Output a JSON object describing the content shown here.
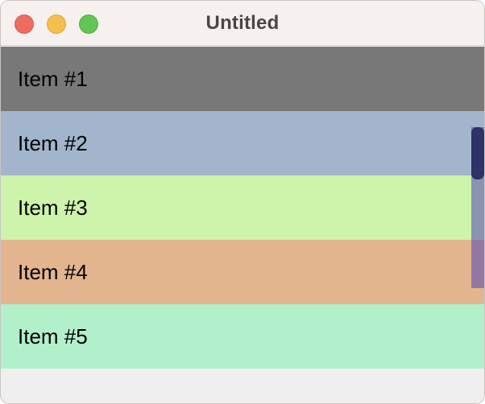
{
  "window": {
    "title": "Untitled",
    "controls": {
      "close_color": "#ef6b5f",
      "minimize_color": "#f6be4f",
      "zoom_color": "#62c554"
    }
  },
  "list": {
    "items": [
      {
        "label": "Item #1",
        "color": "#787878"
      },
      {
        "label": "Item #2",
        "color": "#a2b5cd"
      },
      {
        "label": "Item #3",
        "color": "#cef3ab"
      },
      {
        "label": "Item #4",
        "color": "#e3b58f"
      },
      {
        "label": "Item #5",
        "color": "#b2f0cc"
      }
    ]
  },
  "scrollbar": {
    "track_color": "#7f8fc4",
    "thumb_color": "#2e3266"
  }
}
